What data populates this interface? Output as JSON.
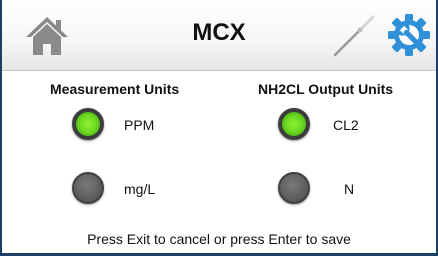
{
  "header": {
    "title": "MCX",
    "home_icon": "home-icon",
    "wrench_icon": "wrench-icon",
    "settings_icon": "gear-wrench-icon"
  },
  "measurement_units": {
    "heading": "Measurement Units",
    "options": [
      {
        "label": "PPM",
        "selected": true
      },
      {
        "label": "mg/L",
        "selected": false
      }
    ]
  },
  "output_units": {
    "heading": "NH2CL Output Units",
    "options": [
      {
        "label": "CL2",
        "selected": true
      },
      {
        "label": "N",
        "selected": false
      }
    ]
  },
  "footer": {
    "message": "Press Exit to cancel or press Enter to save"
  },
  "colors": {
    "border": "#1b3e63",
    "selected_green": "#6edc22",
    "unselected_gray": "#5e5e5e",
    "settings_blue": "#2f8fd8"
  }
}
